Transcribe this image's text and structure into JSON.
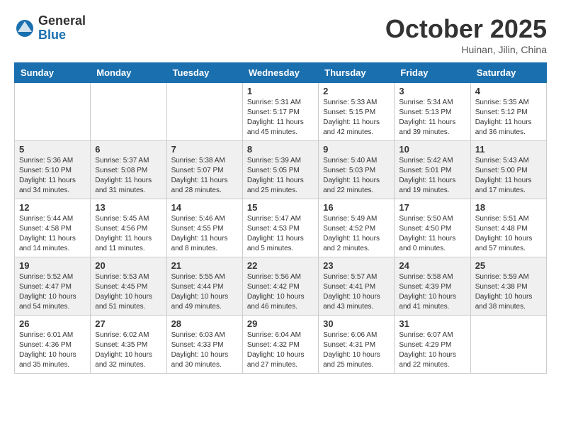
{
  "logo": {
    "general": "General",
    "blue": "Blue"
  },
  "title": "October 2025",
  "location": "Huinan, Jilin, China",
  "days_of_week": [
    "Sunday",
    "Monday",
    "Tuesday",
    "Wednesday",
    "Thursday",
    "Friday",
    "Saturday"
  ],
  "weeks": [
    [
      {
        "day": "",
        "info": ""
      },
      {
        "day": "",
        "info": ""
      },
      {
        "day": "",
        "info": ""
      },
      {
        "day": "1",
        "info": "Sunrise: 5:31 AM\nSunset: 5:17 PM\nDaylight: 11 hours\nand 45 minutes."
      },
      {
        "day": "2",
        "info": "Sunrise: 5:33 AM\nSunset: 5:15 PM\nDaylight: 11 hours\nand 42 minutes."
      },
      {
        "day": "3",
        "info": "Sunrise: 5:34 AM\nSunset: 5:13 PM\nDaylight: 11 hours\nand 39 minutes."
      },
      {
        "day": "4",
        "info": "Sunrise: 5:35 AM\nSunset: 5:12 PM\nDaylight: 11 hours\nand 36 minutes."
      }
    ],
    [
      {
        "day": "5",
        "info": "Sunrise: 5:36 AM\nSunset: 5:10 PM\nDaylight: 11 hours\nand 34 minutes."
      },
      {
        "day": "6",
        "info": "Sunrise: 5:37 AM\nSunset: 5:08 PM\nDaylight: 11 hours\nand 31 minutes."
      },
      {
        "day": "7",
        "info": "Sunrise: 5:38 AM\nSunset: 5:07 PM\nDaylight: 11 hours\nand 28 minutes."
      },
      {
        "day": "8",
        "info": "Sunrise: 5:39 AM\nSunset: 5:05 PM\nDaylight: 11 hours\nand 25 minutes."
      },
      {
        "day": "9",
        "info": "Sunrise: 5:40 AM\nSunset: 5:03 PM\nDaylight: 11 hours\nand 22 minutes."
      },
      {
        "day": "10",
        "info": "Sunrise: 5:42 AM\nSunset: 5:01 PM\nDaylight: 11 hours\nand 19 minutes."
      },
      {
        "day": "11",
        "info": "Sunrise: 5:43 AM\nSunset: 5:00 PM\nDaylight: 11 hours\nand 17 minutes."
      }
    ],
    [
      {
        "day": "12",
        "info": "Sunrise: 5:44 AM\nSunset: 4:58 PM\nDaylight: 11 hours\nand 14 minutes."
      },
      {
        "day": "13",
        "info": "Sunrise: 5:45 AM\nSunset: 4:56 PM\nDaylight: 11 hours\nand 11 minutes."
      },
      {
        "day": "14",
        "info": "Sunrise: 5:46 AM\nSunset: 4:55 PM\nDaylight: 11 hours\nand 8 minutes."
      },
      {
        "day": "15",
        "info": "Sunrise: 5:47 AM\nSunset: 4:53 PM\nDaylight: 11 hours\nand 5 minutes."
      },
      {
        "day": "16",
        "info": "Sunrise: 5:49 AM\nSunset: 4:52 PM\nDaylight: 11 hours\nand 2 minutes."
      },
      {
        "day": "17",
        "info": "Sunrise: 5:50 AM\nSunset: 4:50 PM\nDaylight: 11 hours\nand 0 minutes."
      },
      {
        "day": "18",
        "info": "Sunrise: 5:51 AM\nSunset: 4:48 PM\nDaylight: 10 hours\nand 57 minutes."
      }
    ],
    [
      {
        "day": "19",
        "info": "Sunrise: 5:52 AM\nSunset: 4:47 PM\nDaylight: 10 hours\nand 54 minutes."
      },
      {
        "day": "20",
        "info": "Sunrise: 5:53 AM\nSunset: 4:45 PM\nDaylight: 10 hours\nand 51 minutes."
      },
      {
        "day": "21",
        "info": "Sunrise: 5:55 AM\nSunset: 4:44 PM\nDaylight: 10 hours\nand 49 minutes."
      },
      {
        "day": "22",
        "info": "Sunrise: 5:56 AM\nSunset: 4:42 PM\nDaylight: 10 hours\nand 46 minutes."
      },
      {
        "day": "23",
        "info": "Sunrise: 5:57 AM\nSunset: 4:41 PM\nDaylight: 10 hours\nand 43 minutes."
      },
      {
        "day": "24",
        "info": "Sunrise: 5:58 AM\nSunset: 4:39 PM\nDaylight: 10 hours\nand 41 minutes."
      },
      {
        "day": "25",
        "info": "Sunrise: 5:59 AM\nSunset: 4:38 PM\nDaylight: 10 hours\nand 38 minutes."
      }
    ],
    [
      {
        "day": "26",
        "info": "Sunrise: 6:01 AM\nSunset: 4:36 PM\nDaylight: 10 hours\nand 35 minutes."
      },
      {
        "day": "27",
        "info": "Sunrise: 6:02 AM\nSunset: 4:35 PM\nDaylight: 10 hours\nand 32 minutes."
      },
      {
        "day": "28",
        "info": "Sunrise: 6:03 AM\nSunset: 4:33 PM\nDaylight: 10 hours\nand 30 minutes."
      },
      {
        "day": "29",
        "info": "Sunrise: 6:04 AM\nSunset: 4:32 PM\nDaylight: 10 hours\nand 27 minutes."
      },
      {
        "day": "30",
        "info": "Sunrise: 6:06 AM\nSunset: 4:31 PM\nDaylight: 10 hours\nand 25 minutes."
      },
      {
        "day": "31",
        "info": "Sunrise: 6:07 AM\nSunset: 4:29 PM\nDaylight: 10 hours\nand 22 minutes."
      },
      {
        "day": "",
        "info": ""
      }
    ]
  ]
}
